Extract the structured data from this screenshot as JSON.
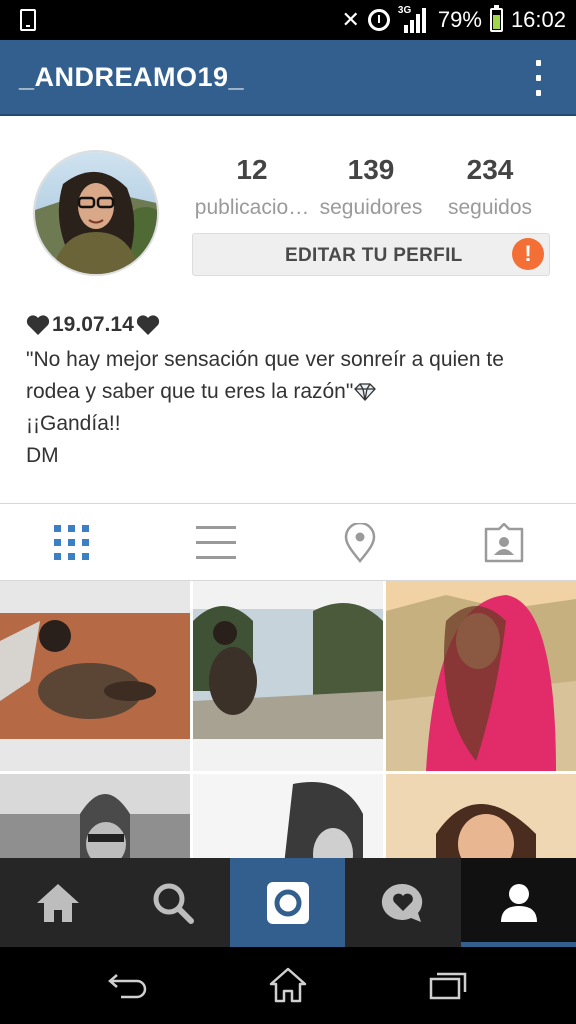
{
  "status_bar": {
    "battery": "79%",
    "time": "16:02",
    "network": "3G",
    "icons": [
      "phone-icon",
      "bluetooth-off-icon",
      "alarm-icon",
      "signal-icon",
      "battery-icon"
    ]
  },
  "header": {
    "username": "_ANDREAMO19_",
    "menu_icon": "overflow-menu-icon",
    "color": "#325f8e"
  },
  "profile": {
    "stats": [
      {
        "value": "12",
        "label": "publicacio…"
      },
      {
        "value": "139",
        "label": "seguidores"
      },
      {
        "value": "234",
        "label": "seguidos"
      }
    ],
    "edit_button_label": "EDITAR TU PERFIL",
    "alert_badge": "!",
    "alert_color": "#f36f35"
  },
  "bio": {
    "name": "19.07.14",
    "line1": "\"No hay mejor sensación que ver sonreír a quien te",
    "line2": "rodea y saber que tu eres la razón\"",
    "line3": "¡¡Gandía!!",
    "line4": "DM"
  },
  "view_tabs": [
    {
      "name": "grid-view-icon",
      "active": true
    },
    {
      "name": "list-view-icon",
      "active": false
    },
    {
      "name": "location-pin-icon",
      "active": false
    },
    {
      "name": "tagged-photos-icon",
      "active": false
    }
  ],
  "app_nav": [
    {
      "name": "home-icon"
    },
    {
      "name": "search-icon"
    },
    {
      "name": "camera-icon"
    },
    {
      "name": "activity-icon"
    },
    {
      "name": "profile-icon"
    }
  ],
  "system_nav": [
    {
      "name": "back-icon"
    },
    {
      "name": "home-button-icon"
    },
    {
      "name": "recent-apps-icon"
    }
  ]
}
